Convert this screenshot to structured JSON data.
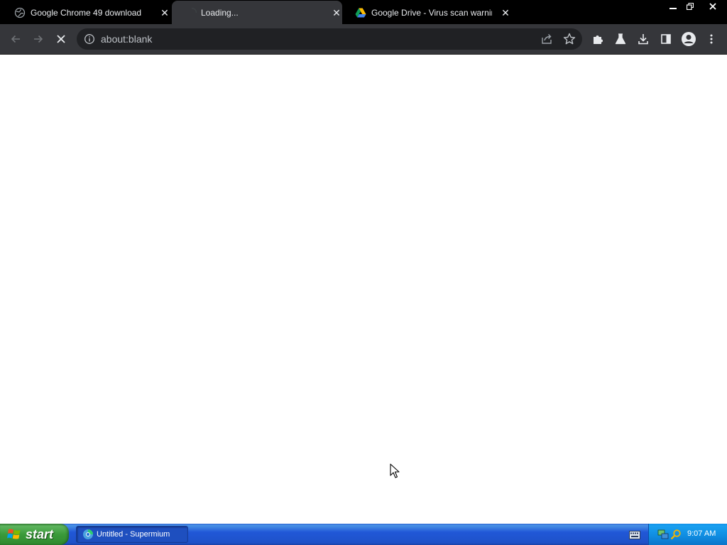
{
  "tabs": [
    {
      "title": "Google Chrome 49 download",
      "icon": "globe-icon",
      "active": false
    },
    {
      "title": "Loading...",
      "icon": "loading-icon",
      "active": true
    },
    {
      "title": "Google Drive - Virus scan warning",
      "icon": "google-drive-icon",
      "active": false
    }
  ],
  "window_controls": {
    "minimize": "minimize-icon",
    "restore": "restore-icon",
    "close": "close-icon"
  },
  "toolbar": {
    "back": "back-arrow-icon",
    "forward": "forward-arrow-icon",
    "stop": "stop-icon",
    "url": "about:blank",
    "right_icons": [
      "extensions-icon",
      "labs-icon",
      "download-icon",
      "side-panel-icon",
      "profile-icon",
      "menu-icon"
    ]
  },
  "taskbar": {
    "start_label": "start",
    "task_item": "Untitled - Supermium",
    "clock": "9:07 AM"
  },
  "colors": {
    "tabstrip": "#000000",
    "toolbar": "#35363a",
    "omnibox": "#202124",
    "taskbar": "#245edb",
    "start_button": "#3a9a3a",
    "tray": "#0f8be0"
  }
}
